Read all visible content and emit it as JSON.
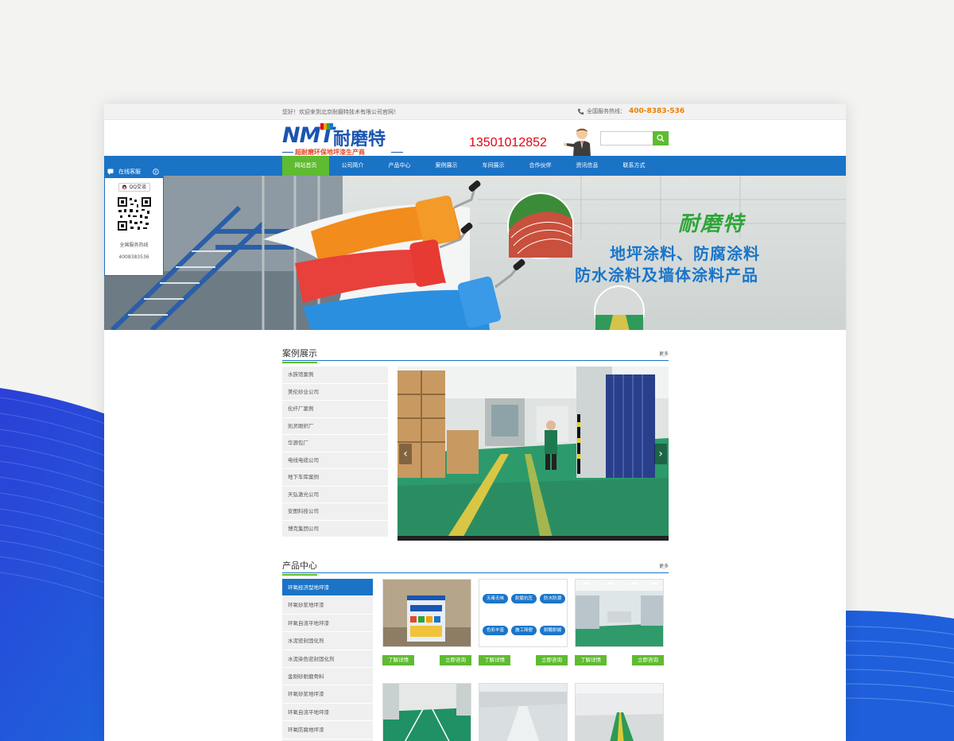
{
  "topbar": {
    "welcome": "您好！欢迎来到北京耐磨特技术有限公司官网！",
    "hotline_label": "全国服务热线：",
    "hotline_number": "400-8383-536"
  },
  "header": {
    "logo_en": "NMT",
    "logo_cn": "耐磨特",
    "slogan": "超耐磨环保地坪漆生产商",
    "mobile": "13501012852",
    "search_placeholder": ""
  },
  "nav": {
    "items": [
      "网站首页",
      "公司简介",
      "产品中心",
      "案例展示",
      "车间展示",
      "合作伙伴",
      "资讯信息",
      "联系方式"
    ],
    "active_index": 0
  },
  "banner": {
    "brand": "耐磨特",
    "line1": "地坪涂料、防腐涂料",
    "line2": "防水涂料及墙体涂料产品"
  },
  "customer_service": {
    "title": "在线客服",
    "qq_label": "QQ交谈",
    "hotline_label": "全国服务热线",
    "hotline_number": "4008383536"
  },
  "cases": {
    "title": "案例展示",
    "more": "更多",
    "items": [
      "水族馆案例",
      "美伦砂业公司",
      "化纤厂案例",
      "凯灵眼织厂",
      "华源包厂",
      "电线电缆公司",
      "地下车库案例",
      "天弘激光公司",
      "安图科技公司",
      "博克集团公司"
    ],
    "prev": "‹",
    "next": "›"
  },
  "products": {
    "title": "产品中心",
    "more": "更多",
    "items": [
      "环氧经济型地坪漆",
      "环氧砂浆地坪漆",
      "环氧自流平地坪漆",
      "水泥密封固化剂",
      "水泥染色密封固化剂",
      "金刚砂耐磨骨料",
      "环氧砂浆地坪漆",
      "环氧自流平地坪漆",
      "环氧防腐地坪漆"
    ],
    "active_index": 0,
    "btn_detail": "了解详情",
    "btn_consult": "立即咨询",
    "features": [
      "无毒无味",
      "耐磨抗压",
      "防水防潮",
      "色彩丰富",
      "施工简便",
      "耐酸耐碱"
    ]
  },
  "colors": {
    "nav_blue": "#1b73c6",
    "accent_green": "#5fbb31",
    "hotline_orange": "#ef7d00",
    "mobile_red": "#e60012"
  }
}
